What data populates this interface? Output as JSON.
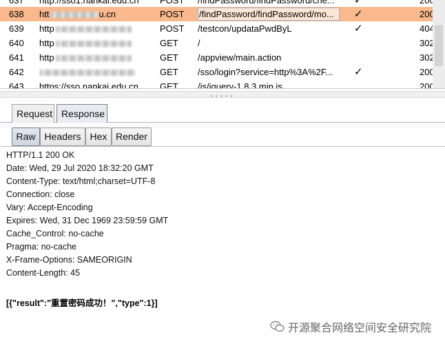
{
  "history": {
    "rows": [
      {
        "num": "637",
        "host": "http://sso1.nankai.edu.cn",
        "method": "POST",
        "url": "/findPassword/findPassword/che...",
        "check": "✓",
        "status": "200",
        "selected": false
      },
      {
        "num": "638",
        "host": "htt",
        "host_suffix": "u.cn",
        "method": "POST",
        "url": "/findPassword/findPassword/mo...",
        "check": "✓",
        "status": "200",
        "selected": true
      },
      {
        "num": "639",
        "host": "http",
        "method": "POST",
        "url": "/testcon/updataPwdByL",
        "check": "✓",
        "status": "404",
        "selected": false
      },
      {
        "num": "640",
        "host": "http",
        "method": "GET",
        "url": "/",
        "check": "",
        "status": "302",
        "selected": false
      },
      {
        "num": "641",
        "host": "http",
        "method": "GET",
        "url": "/appview/main.action",
        "check": "",
        "status": "302",
        "selected": false
      },
      {
        "num": "642",
        "host": "",
        "method": "GET",
        "url": "/sso/login?service=http%3A%2F...",
        "check": "✓",
        "status": "200",
        "selected": false
      },
      {
        "num": "643",
        "host": "https://sso.nankai.edu.cn",
        "method": "GET",
        "url": "/js/jquery-1.8.3.min.js",
        "check": "",
        "status": "200",
        "selected": false
      }
    ]
  },
  "tabs": {
    "request": "Request",
    "response": "Response"
  },
  "subtabs": {
    "raw": "Raw",
    "headers": "Headers",
    "hex": "Hex",
    "render": "Render"
  },
  "response": {
    "lines": [
      "HTTP/1.1 200 OK",
      "Date: Wed, 29 Jul 2020 18:32:20 GMT",
      "Content-Type: text/html;charset=UTF-8",
      "Connection: close",
      "Vary: Accept-Encoding",
      "Expires: Wed, 31 Dec 1969 23:59:59 GMT",
      "Cache_Control: no-cache",
      "Pragma: no-cache",
      "X-Frame-Options: SAMEORIGIN",
      "Content-Length: 45"
    ],
    "body": "[{\"result\":\"重置密码成功！\",\"type\":1}]"
  },
  "watermark": {
    "text": "开源聚合网络空间安全研究院",
    "icon": "wechat-icon"
  },
  "colors": {
    "selected_row": "#f9b98c",
    "active_tab": "#e7ebf1"
  }
}
